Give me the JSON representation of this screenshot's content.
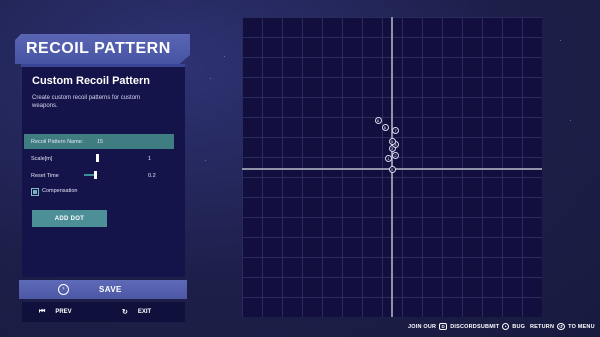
{
  "panel": {
    "title": "RECOIL PATTERN",
    "heading": "Custom Recoil Pattern",
    "description": "Create custom recoil patterns for custom weapons."
  },
  "fields": {
    "pattern_name_label": "Recoil Pattern Name:",
    "pattern_name_value": "15",
    "scale_label": "Scale[m]",
    "scale_value": "1",
    "scale_level": 0.3,
    "reset_label": "Reset Time",
    "reset_value": "0.2",
    "reset_level": 0.25,
    "compensation_label": "Compensation",
    "compensation_checked": true
  },
  "buttons": {
    "add_dot": "ADD DOT",
    "save": "SAVE",
    "prev": "PREV",
    "exit": "EXIT"
  },
  "footer": {
    "join_our": "JOIN OUR",
    "discord": "DISCORD",
    "submit": "SUBMIT",
    "bug": "BUG",
    "return": "RETURN",
    "to_menu": "TO MENU"
  },
  "grid_dots": [
    {
      "label": "0",
      "x": 0,
      "y": 0
    },
    {
      "label": "1",
      "x": -1,
      "y": 3
    },
    {
      "label": "2",
      "x": 1,
      "y": 4
    },
    {
      "label": "3",
      "x": 0,
      "y": 6
    },
    {
      "label": "4",
      "x": 1,
      "y": 7
    },
    {
      "label": "5",
      "x": 0,
      "y": 8
    },
    {
      "label": "6",
      "x": -2,
      "y": 12
    },
    {
      "label": "7",
      "x": 1,
      "y": 11
    },
    {
      "label": "8",
      "x": -4,
      "y": 14
    }
  ],
  "icons": {
    "save": "circle-arrow-icon",
    "prev": "skip-back-icon",
    "exit": "refresh-icon"
  },
  "colors": {
    "accent": "#4c8f96",
    "header": "#4c58a4"
  }
}
